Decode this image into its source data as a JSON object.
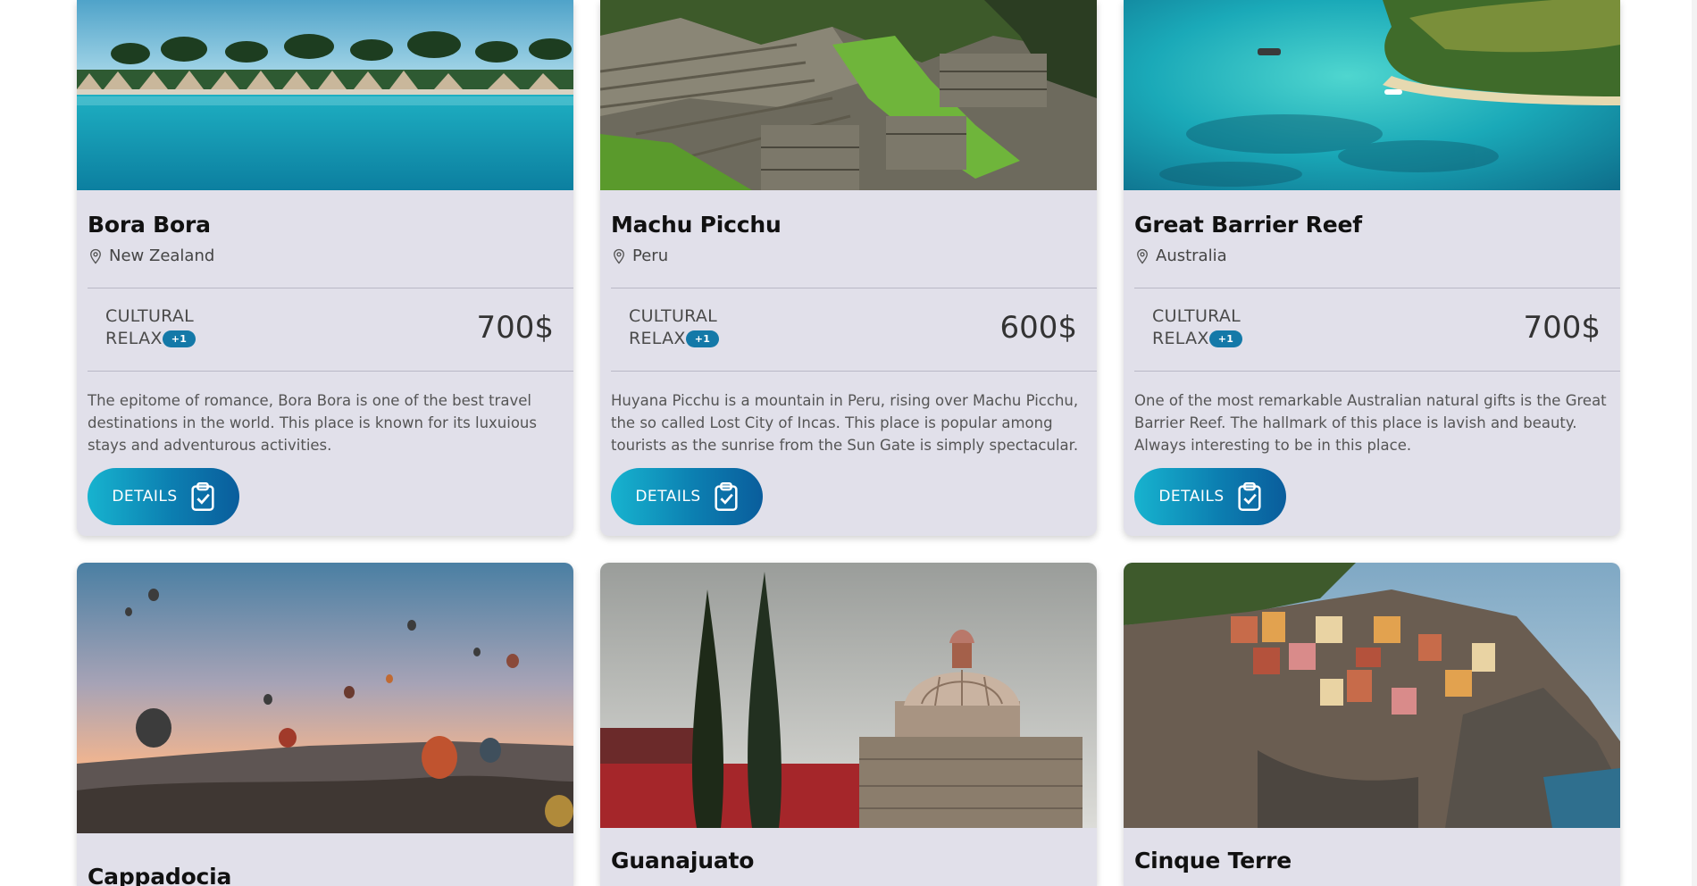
{
  "cards": [
    {
      "title": "Bora Bora",
      "location": "New Zealand",
      "tag1": "CULTURAL",
      "tag2": "RELAX",
      "badge": "+1",
      "price": "700$",
      "description": "The epitome of romance, Bora Bora is one of the best travel destinations in the world. This place is known for its luxuious stays and adventurous activities.",
      "button_label": "DETAILS"
    },
    {
      "title": "Machu Picchu",
      "location": "Peru",
      "tag1": "CULTURAL",
      "tag2": "RELAX",
      "badge": "+1",
      "price": "600$",
      "description": "Huyana Picchu is a mountain in Peru, rising over Machu Picchu, the so called Lost City of Incas. This place is popular among tourists as the sunrise from the Sun Gate is simply spectacular.",
      "button_label": "DETAILS"
    },
    {
      "title": "Great Barrier Reef",
      "location": "Australia",
      "tag1": "CULTURAL",
      "tag2": "RELAX",
      "badge": "+1",
      "price": "700$",
      "description": "One of the most remarkable Australian natural gifts is the Great Barrier Reef. The hallmark of this place is lavish and beauty. Always interesting to be in this place.",
      "button_label": "DETAILS"
    },
    {
      "title": "Cappadocia"
    },
    {
      "title": "Guanajuato"
    },
    {
      "title": "Cinque Terre"
    }
  ],
  "colors": {
    "card_bg": "#e1e0ea",
    "button_gradient_start": "#17b3cf",
    "button_gradient_end": "#0a5d9c",
    "badge": "#1479a8"
  },
  "icons": {
    "location": "map-pin-icon",
    "details": "clipboard-check-icon"
  }
}
